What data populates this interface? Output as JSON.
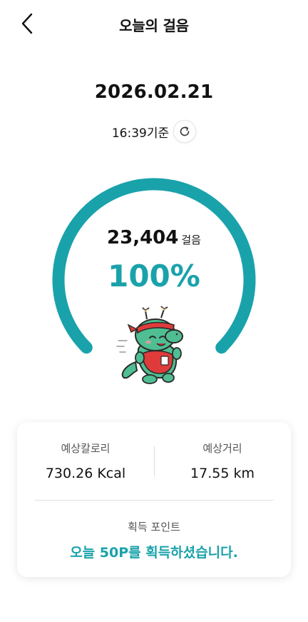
{
  "header": {
    "title": "오늘의 걸음",
    "back_icon": "chevron-left-icon"
  },
  "summary": {
    "date": "2026.02.21",
    "time_label": "16:39기준",
    "refresh_icon": "refresh-icon"
  },
  "progress": {
    "steps": "23,404",
    "steps_unit": "걸음",
    "percent_label": "100%",
    "percent_value": 100,
    "color": "#1aa2ab"
  },
  "stats": {
    "calories_label": "예상칼로리",
    "calories_value": "730.26 Kcal",
    "distance_label": "예상거리",
    "distance_value": "17.55 km"
  },
  "points": {
    "label": "획득 포인트",
    "message": "오늘 50P를 획득하셨습니다."
  },
  "colors": {
    "accent": "#1aa2ab",
    "mascot_green": "#4fbf93",
    "mascot_red": "#e03b3b"
  }
}
